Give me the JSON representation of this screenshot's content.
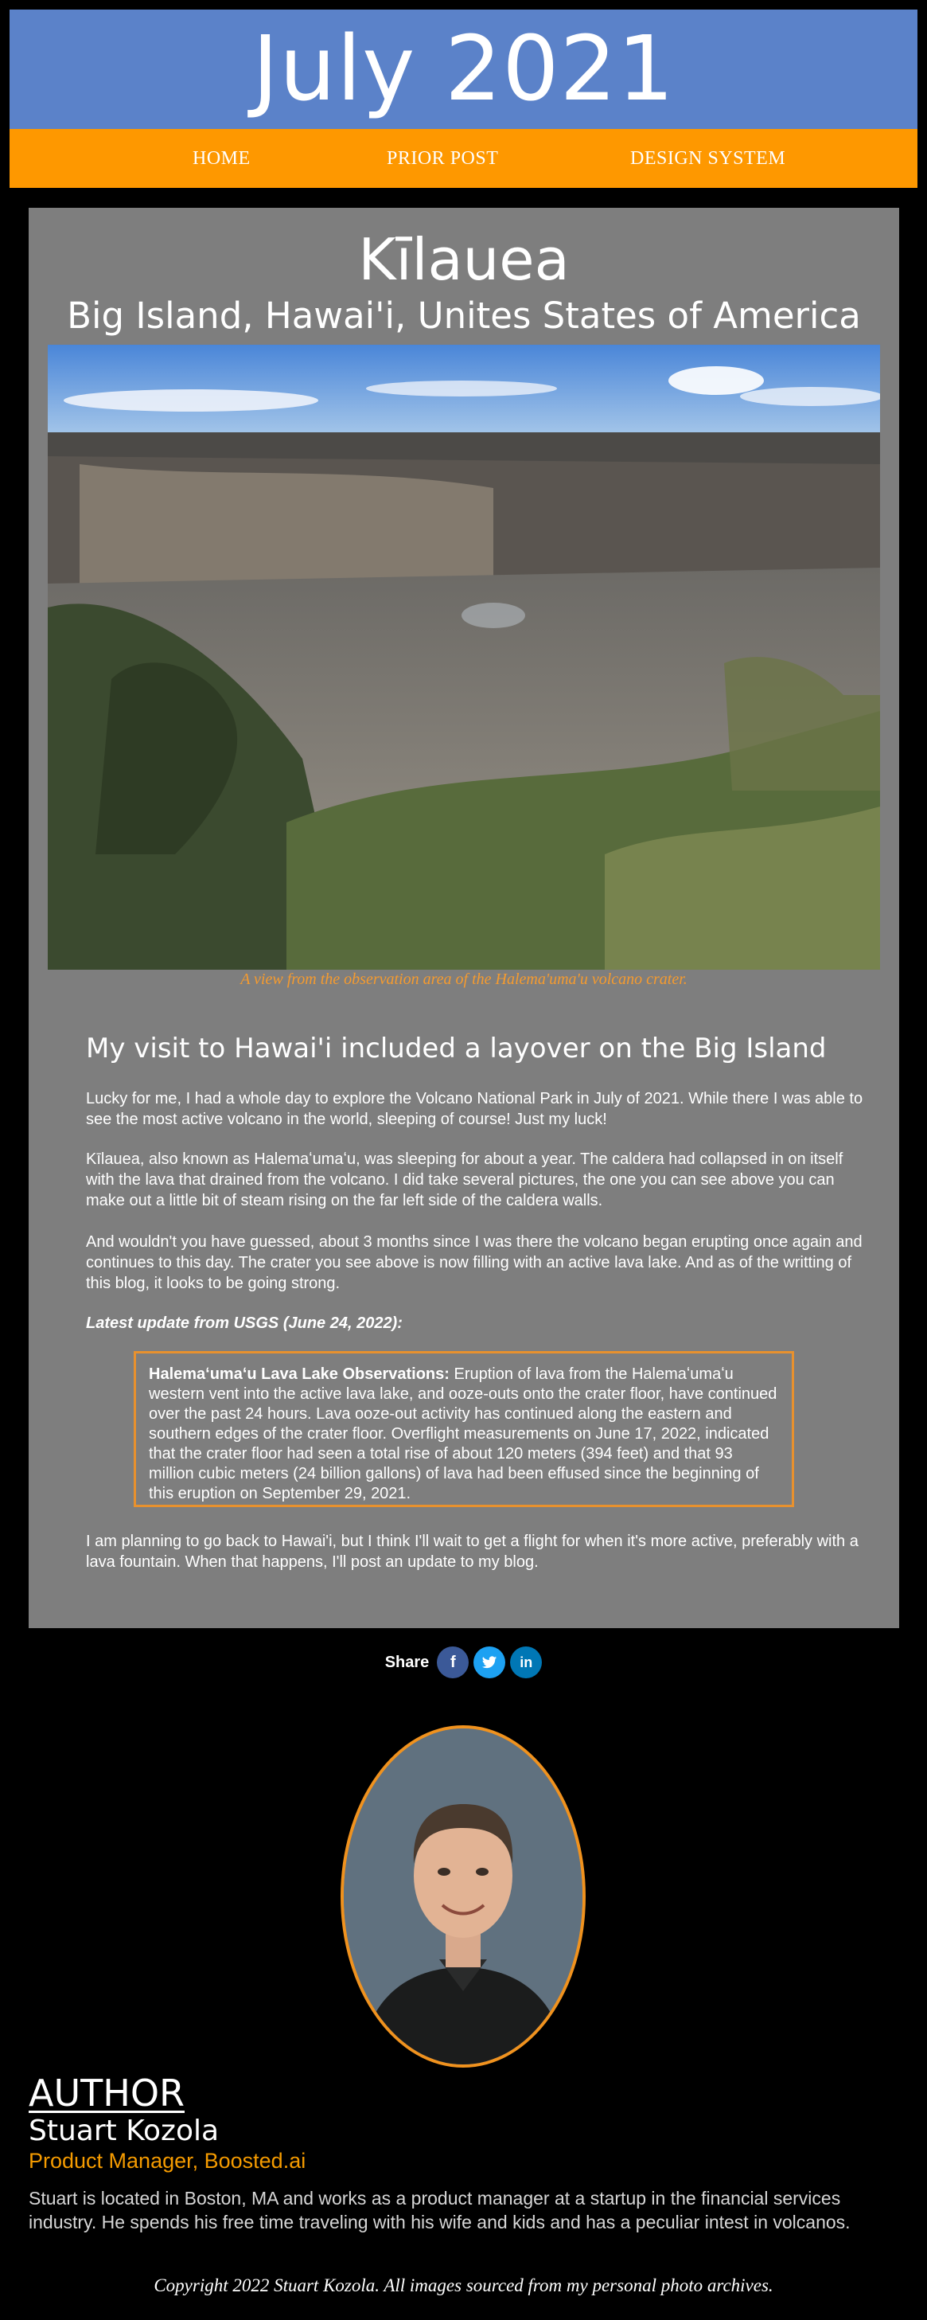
{
  "header": {
    "title": "July 2021",
    "nav": [
      "HOME",
      "PRIOR POST",
      "DESIGN SYSTEM"
    ]
  },
  "post": {
    "title": "Kīlauea",
    "subtitle": "Big Island, Hawai'i, Unites States of America",
    "photo_alt": "Halema'uma'u volcano crater",
    "caption": "A view from the observation area of the Halema'uma'u volcano crater.",
    "heading": "My visit to Hawai'i included a layover on the Big Island",
    "p1": "Lucky for me, I had a whole day to explore the Volcano National Park in July of 2021. While there I was able to see the most active volcano in the world, sleeping of course! Just my luck!",
    "p2": "Kīlauea, also known as Halemaʻumaʻu, was sleeping for about a year. The caldera had collapsed in on itself with the lava that drained from the volcano. I did take several pictures, the one you can see above you can make out a little bit of steam rising on the far left side of the caldera walls.",
    "p3": "And wouldn't you have guessed, about 3 months since I was there the volcano began erupting once again and continues to this day. The crater you see above is now filling with an active lava lake. And as of the writting of this blog, it looks to be going strong.",
    "usgs_label": "Latest update from USGS (June 24, 2022):",
    "quote_title": "Halemaʻumaʻu Lava Lake Observations:",
    "quote_body": " Eruption of lava from the Halemaʻumaʻu western vent into the active lava lake, and ooze-outs onto the crater floor, have continued over the past 24 hours. Lava ooze-out activity has continued along the eastern and southern edges of the crater floor. Overflight measurements on June 17, 2022, indicated that the crater floor had seen a total rise of about 120 meters (394 feet) and that 93 million cubic meters (24 billion gallons) of lava had been effused since the beginning of this eruption on September 29, 2021.",
    "p4": "I am planning to go back to Hawai'i, but I think I'll wait to get a flight for when it's more active, preferably with a lava fountain. When that happens, I'll post an update to my blog."
  },
  "share": {
    "label": "Share",
    "facebook": "f",
    "twitter": "t",
    "linkedin": "in",
    "icons": [
      "facebook-icon",
      "twitter-icon",
      "linkedin-icon"
    ],
    "colors": [
      "#3b5998",
      "#1da1f2",
      "#0077b5"
    ]
  },
  "author": {
    "heading": "AUTHOR",
    "name": "Stuart Kozola",
    "role": "Product Manager, Boosted.ai",
    "bio": "Stuart is located in Boston, MA and works as a product manager at a startup in the financial services industry. He spends his free time traveling with his wife and kids and has a peculiar intest in volcanos."
  },
  "footer": {
    "copyright": "Copyright 2022 Stuart Kozola. All images sourced from my personal photo archives."
  },
  "colors": {
    "banner": "#5b82c9",
    "nav": "#fe9800",
    "card": "#7e7e7e",
    "accent": "#f59b00"
  }
}
